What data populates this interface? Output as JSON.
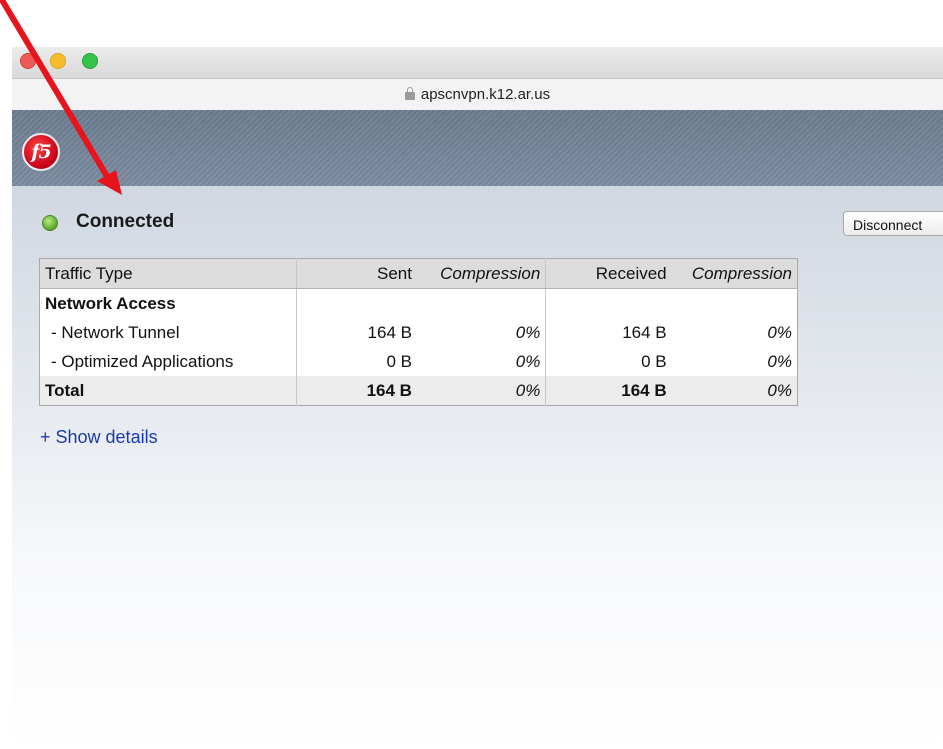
{
  "browser": {
    "url": "apscnvpn.k12.ar.us"
  },
  "header": {
    "logo_text": "f5"
  },
  "status": {
    "label": "Connected",
    "color": "#6fbf3a"
  },
  "actions": {
    "disconnect_label": "Disconnect"
  },
  "traffic_table": {
    "headers": {
      "type": "Traffic Type",
      "sent": "Sent",
      "sent_compression": "Compression",
      "received": "Received",
      "received_compression": "Compression"
    },
    "section": "Network Access",
    "rows": [
      {
        "type": "- Network Tunnel",
        "sent": "164 B",
        "sent_compression": "0%",
        "received": "164 B",
        "received_compression": "0%"
      },
      {
        "type": "- Optimized Applications",
        "sent": "0 B",
        "sent_compression": "0%",
        "received": "0 B",
        "received_compression": "0%"
      }
    ],
    "total": {
      "type": "Total",
      "sent": "164 B",
      "sent_compression": "0%",
      "received": "164 B",
      "received_compression": "0%"
    }
  },
  "links": {
    "show_details": "+ Show details"
  },
  "annotation": {
    "arrow_color": "#e8141c"
  }
}
